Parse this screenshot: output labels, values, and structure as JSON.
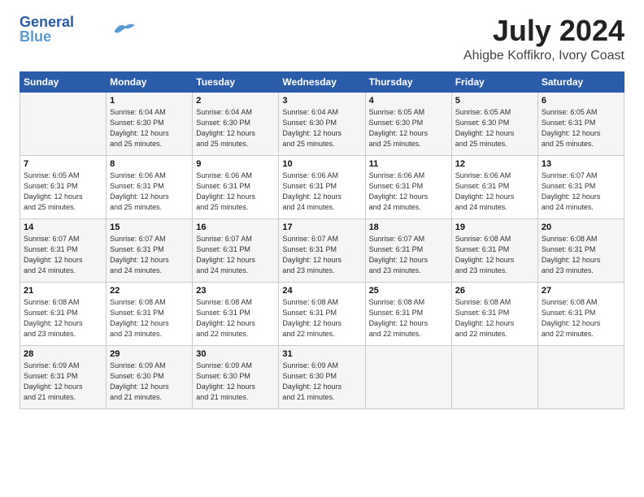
{
  "logo": {
    "line1": "General",
    "line2": "Blue"
  },
  "title": "July 2024",
  "subtitle": "Ahigbe Koffikro, Ivory Coast",
  "days": [
    "Sunday",
    "Monday",
    "Tuesday",
    "Wednesday",
    "Thursday",
    "Friday",
    "Saturday"
  ],
  "weeks": [
    [
      {
        "day": "",
        "info": ""
      },
      {
        "day": "1",
        "info": "Sunrise: 6:04 AM\nSunset: 6:30 PM\nDaylight: 12 hours\nand 25 minutes."
      },
      {
        "day": "2",
        "info": "Sunrise: 6:04 AM\nSunset: 6:30 PM\nDaylight: 12 hours\nand 25 minutes."
      },
      {
        "day": "3",
        "info": "Sunrise: 6:04 AM\nSunset: 6:30 PM\nDaylight: 12 hours\nand 25 minutes."
      },
      {
        "day": "4",
        "info": "Sunrise: 6:05 AM\nSunset: 6:30 PM\nDaylight: 12 hours\nand 25 minutes."
      },
      {
        "day": "5",
        "info": "Sunrise: 6:05 AM\nSunset: 6:30 PM\nDaylight: 12 hours\nand 25 minutes."
      },
      {
        "day": "6",
        "info": "Sunrise: 6:05 AM\nSunset: 6:31 PM\nDaylight: 12 hours\nand 25 minutes."
      }
    ],
    [
      {
        "day": "7",
        "info": "Sunrise: 6:05 AM\nSunset: 6:31 PM\nDaylight: 12 hours\nand 25 minutes."
      },
      {
        "day": "8",
        "info": "Sunrise: 6:06 AM\nSunset: 6:31 PM\nDaylight: 12 hours\nand 25 minutes."
      },
      {
        "day": "9",
        "info": "Sunrise: 6:06 AM\nSunset: 6:31 PM\nDaylight: 12 hours\nand 25 minutes."
      },
      {
        "day": "10",
        "info": "Sunrise: 6:06 AM\nSunset: 6:31 PM\nDaylight: 12 hours\nand 24 minutes."
      },
      {
        "day": "11",
        "info": "Sunrise: 6:06 AM\nSunset: 6:31 PM\nDaylight: 12 hours\nand 24 minutes."
      },
      {
        "day": "12",
        "info": "Sunrise: 6:06 AM\nSunset: 6:31 PM\nDaylight: 12 hours\nand 24 minutes."
      },
      {
        "day": "13",
        "info": "Sunrise: 6:07 AM\nSunset: 6:31 PM\nDaylight: 12 hours\nand 24 minutes."
      }
    ],
    [
      {
        "day": "14",
        "info": "Sunrise: 6:07 AM\nSunset: 6:31 PM\nDaylight: 12 hours\nand 24 minutes."
      },
      {
        "day": "15",
        "info": "Sunrise: 6:07 AM\nSunset: 6:31 PM\nDaylight: 12 hours\nand 24 minutes."
      },
      {
        "day": "16",
        "info": "Sunrise: 6:07 AM\nSunset: 6:31 PM\nDaylight: 12 hours\nand 24 minutes."
      },
      {
        "day": "17",
        "info": "Sunrise: 6:07 AM\nSunset: 6:31 PM\nDaylight: 12 hours\nand 23 minutes."
      },
      {
        "day": "18",
        "info": "Sunrise: 6:07 AM\nSunset: 6:31 PM\nDaylight: 12 hours\nand 23 minutes."
      },
      {
        "day": "19",
        "info": "Sunrise: 6:08 AM\nSunset: 6:31 PM\nDaylight: 12 hours\nand 23 minutes."
      },
      {
        "day": "20",
        "info": "Sunrise: 6:08 AM\nSunset: 6:31 PM\nDaylight: 12 hours\nand 23 minutes."
      }
    ],
    [
      {
        "day": "21",
        "info": "Sunrise: 6:08 AM\nSunset: 6:31 PM\nDaylight: 12 hours\nand 23 minutes."
      },
      {
        "day": "22",
        "info": "Sunrise: 6:08 AM\nSunset: 6:31 PM\nDaylight: 12 hours\nand 23 minutes."
      },
      {
        "day": "23",
        "info": "Sunrise: 6:08 AM\nSunset: 6:31 PM\nDaylight: 12 hours\nand 22 minutes."
      },
      {
        "day": "24",
        "info": "Sunrise: 6:08 AM\nSunset: 6:31 PM\nDaylight: 12 hours\nand 22 minutes."
      },
      {
        "day": "25",
        "info": "Sunrise: 6:08 AM\nSunset: 6:31 PM\nDaylight: 12 hours\nand 22 minutes."
      },
      {
        "day": "26",
        "info": "Sunrise: 6:08 AM\nSunset: 6:31 PM\nDaylight: 12 hours\nand 22 minutes."
      },
      {
        "day": "27",
        "info": "Sunrise: 6:08 AM\nSunset: 6:31 PM\nDaylight: 12 hours\nand 22 minutes."
      }
    ],
    [
      {
        "day": "28",
        "info": "Sunrise: 6:09 AM\nSunset: 6:31 PM\nDaylight: 12 hours\nand 21 minutes."
      },
      {
        "day": "29",
        "info": "Sunrise: 6:09 AM\nSunset: 6:30 PM\nDaylight: 12 hours\nand 21 minutes."
      },
      {
        "day": "30",
        "info": "Sunrise: 6:09 AM\nSunset: 6:30 PM\nDaylight: 12 hours\nand 21 minutes."
      },
      {
        "day": "31",
        "info": "Sunrise: 6:09 AM\nSunset: 6:30 PM\nDaylight: 12 hours\nand 21 minutes."
      },
      {
        "day": "",
        "info": ""
      },
      {
        "day": "",
        "info": ""
      },
      {
        "day": "",
        "info": ""
      }
    ]
  ]
}
